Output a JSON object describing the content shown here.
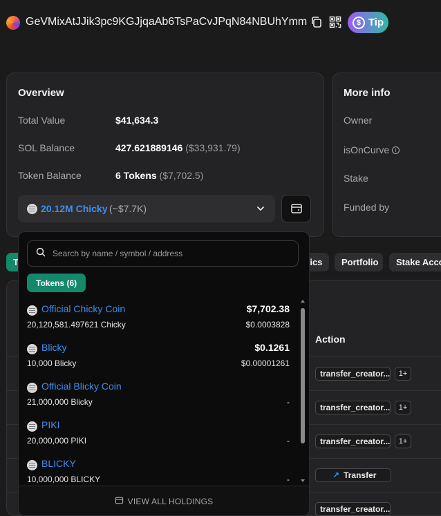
{
  "header": {
    "address": "GeVMixAtJJik3pc9KGJjqaAb6TsPaCvJPqN84NBUhYmm",
    "tip_label": "Tip",
    "tip_icon": "dollar-circle-icon"
  },
  "overview": {
    "title": "Overview",
    "total_value_label": "Total Value",
    "total_value": "$41,634.3",
    "sol_balance_label": "SOL Balance",
    "sol_balance": "427.621889146",
    "sol_balance_usd": "($33,931.79)",
    "token_balance_label": "Token Balance",
    "token_balance": "6 Tokens",
    "token_balance_usd": "($7,702.5)",
    "selected_token_amount": "20.12M Chicky",
    "selected_token_usd": "(~$7.7K)"
  },
  "more_info": {
    "title": "More info",
    "owner_label": "Owner",
    "oncurve_label": "isOnCurve",
    "stake_label": "Stake",
    "funded_label": "Funded by"
  },
  "tabs": [
    "T",
    "tics",
    "Portfolio",
    "Stake Accou"
  ],
  "table": {
    "action_header": "Action",
    "actions": [
      {
        "label": "transfer_creator...",
        "extra": "1+"
      },
      {
        "label": "transfer_creator...",
        "extra": "1+"
      },
      {
        "label": "transfer_creator...",
        "extra": "1+"
      },
      {
        "label": "Transfer",
        "extra": ""
      },
      {
        "label": "transfer_creator...",
        "extra": ""
      }
    ]
  },
  "dropdown": {
    "search_placeholder": "Search by name / symbol / address",
    "tokens_badge": "Tokens (6)",
    "items": [
      {
        "name": "Official Chicky Coin",
        "amount": "20,120,581.497621 Chicky",
        "value": "$7,702.38",
        "price": "$0.0003828"
      },
      {
        "name": "Blicky",
        "amount": "10,000 Blicky",
        "value": "$0.1261",
        "price": "$0.00001261"
      },
      {
        "name": "Official Blicky Coin",
        "amount": "21,000,000 Blicky",
        "value": "",
        "price": "-"
      },
      {
        "name": "PIKI",
        "amount": "20,000,000 PIKI",
        "value": "",
        "price": "-"
      },
      {
        "name": "BLICKY",
        "amount": "10,000,000 BLICKY",
        "value": "",
        "price": "-"
      }
    ],
    "footer_label": "VIEW ALL HOLDINGS"
  },
  "colors": {
    "background": "#1b1b1c",
    "card": "#232325",
    "link": "#3d8ff0",
    "accent_green": "#13896a"
  }
}
